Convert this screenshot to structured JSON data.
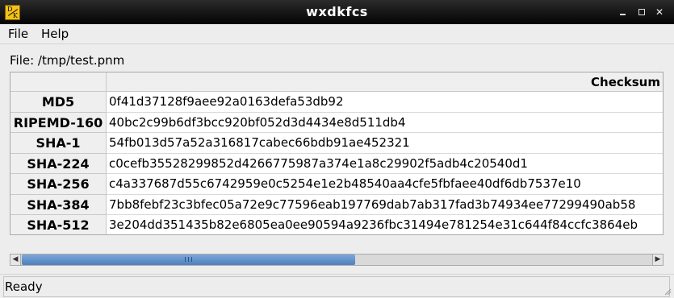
{
  "window": {
    "title": "wxdkfcs",
    "icon": "dk-app-icon",
    "icon_letters": {
      "top": "D",
      "bottom": "K"
    }
  },
  "menu": {
    "items": [
      "File",
      "Help"
    ]
  },
  "file": {
    "label": "File: /tmp/test.pnm"
  },
  "grid": {
    "column_header": "Checksum",
    "rows": [
      {
        "label": "MD5",
        "value": "0f41d37128f9aee92a0163defa53db92"
      },
      {
        "label": "RIPEMD-160",
        "value": "40bc2c99b6df3bcc920bf052d3d4434e8d511db4"
      },
      {
        "label": "SHA-1",
        "value": "54fb013d57a52a316817cabec66bdb91ae452321"
      },
      {
        "label": "SHA-224",
        "value": "c0cefb35528299852d4266775987a374e1a8c29902f5adb4c20540d1"
      },
      {
        "label": "SHA-256",
        "value": "c4a337687d55c6742959e0c5254e1e2b48540aa4cfe5fbfaee40df6db7537e10"
      },
      {
        "label": "SHA-384",
        "value": "7bb8febf23c3bfec05a72e9c77596eab197769dab7ab317fad3b74934ee77299490ab58"
      },
      {
        "label": "SHA-512",
        "value": "3e204dd351435b82e6805ea0ee90594a9236fbc31494e781254e31c644f84ccfc3864eb"
      }
    ]
  },
  "scrollbar": {
    "position": 0.0,
    "visible_fraction": 0.53
  },
  "status": {
    "text": "Ready"
  },
  "colors": {
    "titlebar": "#1a1a1a",
    "thumb": "#5b8bc9",
    "header_bg": "#efefef"
  }
}
